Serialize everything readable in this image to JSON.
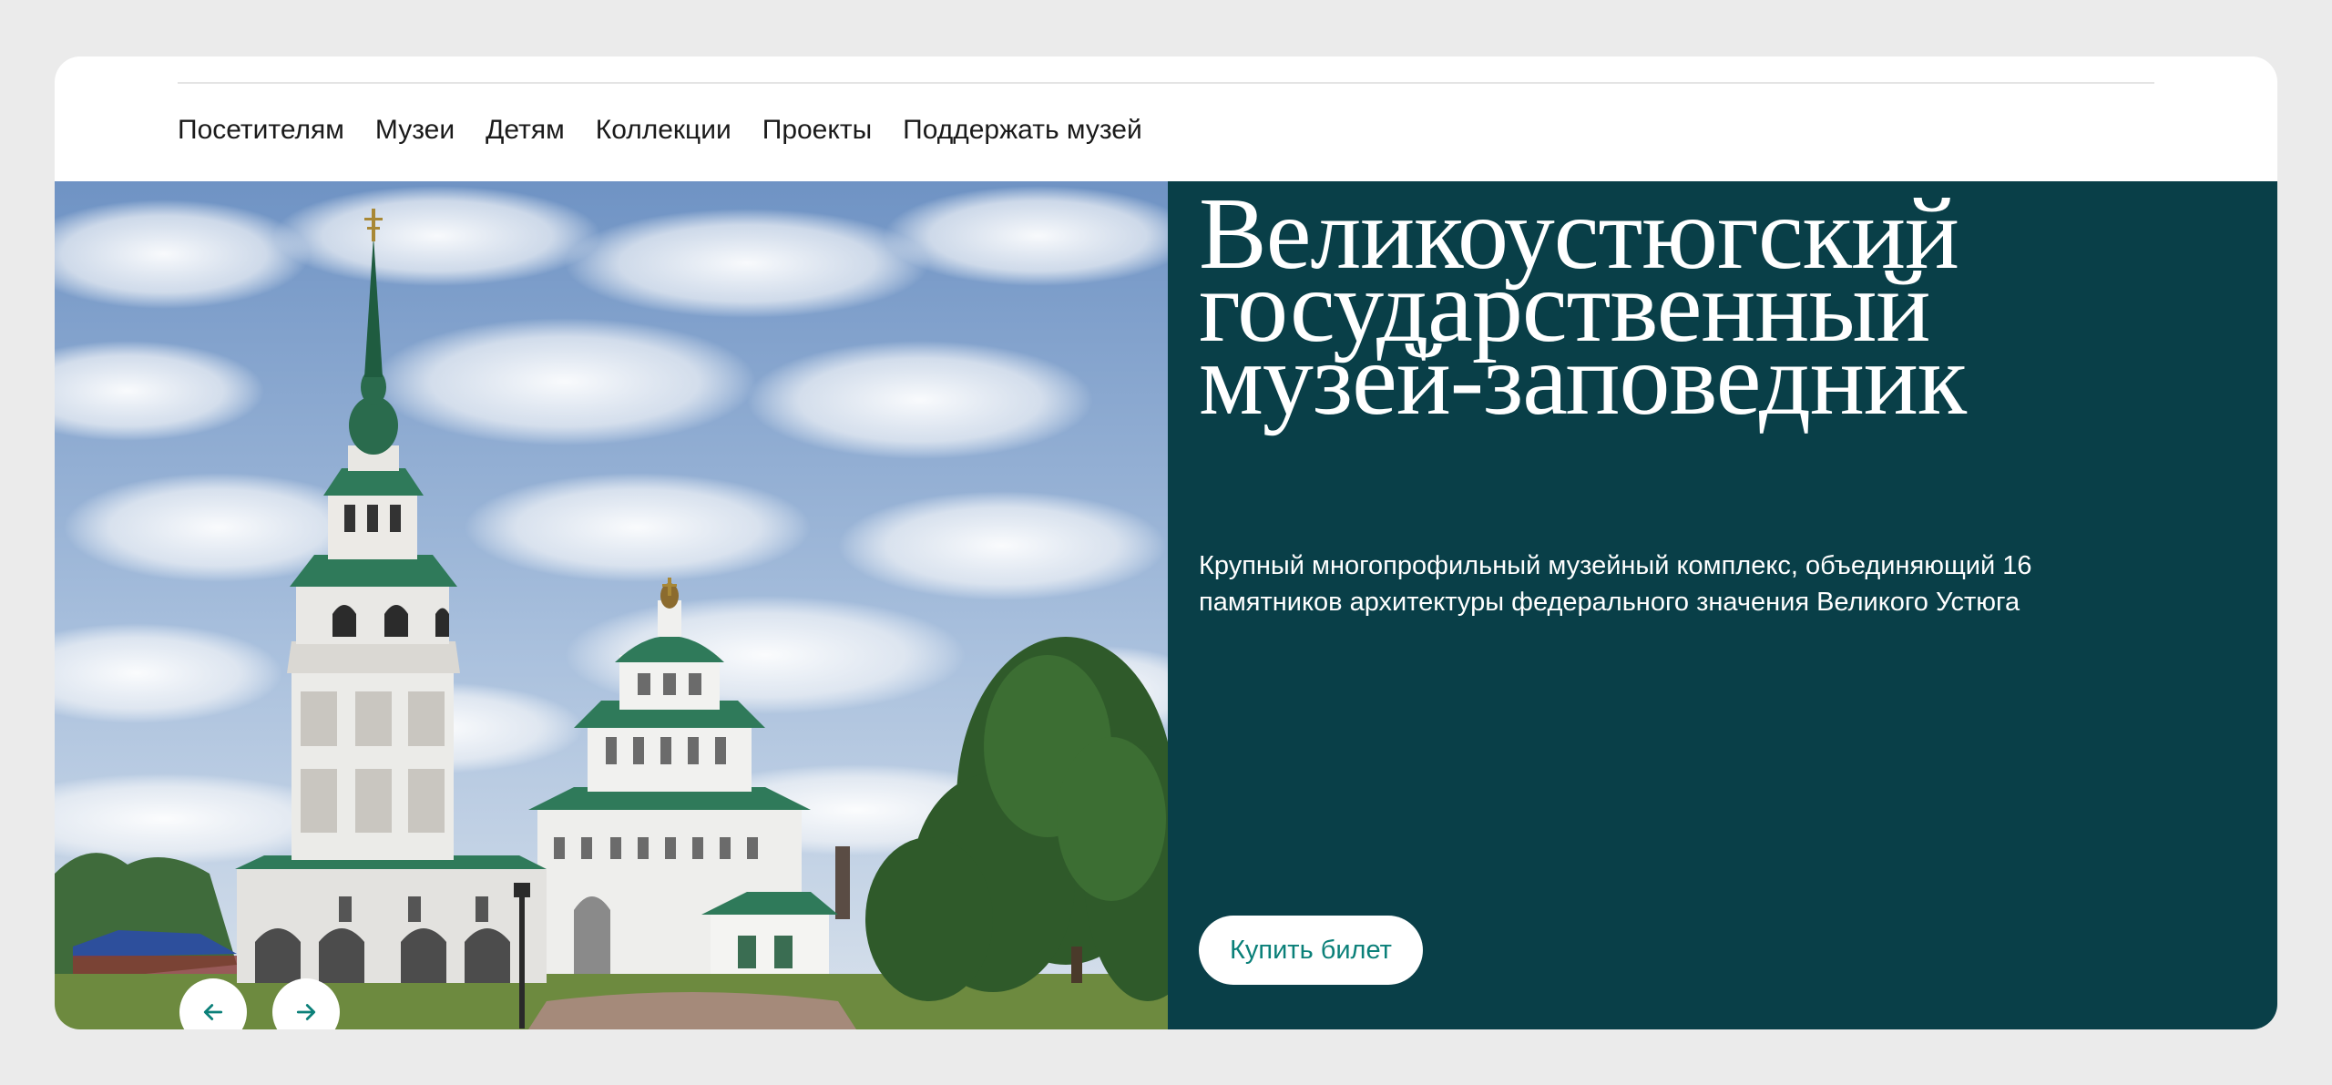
{
  "nav": {
    "items": [
      {
        "label": "Посетителям"
      },
      {
        "label": "Музеи"
      },
      {
        "label": "Детям"
      },
      {
        "label": "Коллекции"
      },
      {
        "label": "Проекты"
      },
      {
        "label": "Поддержать музей"
      }
    ]
  },
  "hero": {
    "title_lines": [
      "Великоустюгский",
      "государственный",
      "музей-заповедник"
    ],
    "description": "Крупный многопрофильный музейный комплекс, объединяющий 16 памятников архитектуры федерального значения Великого Устюга",
    "buy_label": "Купить билет",
    "photo_icon": "church-photo",
    "prev_icon": "arrow-left-icon",
    "next_icon": "arrow-right-icon"
  },
  "colors": {
    "page_bg": "#ebebeb",
    "panel": "#093f48",
    "accent": "#0b8079",
    "roof": "#2f7a5a"
  }
}
